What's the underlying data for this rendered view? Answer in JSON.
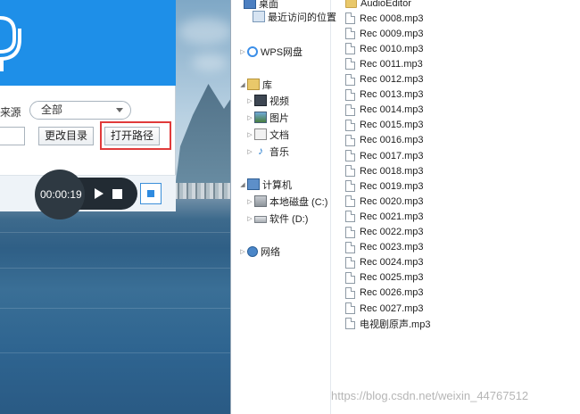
{
  "recorder": {
    "source_label": "来源",
    "source_select_value": "全部",
    "change_dir_label": "更改目录",
    "open_path_label": "打开路径",
    "timer": "00:00:19"
  },
  "explorer": {
    "nav": {
      "desktop": "桌面",
      "recent": "最近访问的位置",
      "wps": "WPS网盘",
      "library": "库",
      "video": "视频",
      "pictures": "图片",
      "documents": "文档",
      "music": "音乐",
      "computer": "计算机",
      "local_disk": "本地磁盘 (C:)",
      "software": "软件 (D:)",
      "network": "网络"
    },
    "files": [
      "AudioEditor",
      "Rec 0008.mp3",
      "Rec 0009.mp3",
      "Rec 0010.mp3",
      "Rec 0011.mp3",
      "Rec 0012.mp3",
      "Rec 0013.mp3",
      "Rec 0014.mp3",
      "Rec 0015.mp3",
      "Rec 0016.mp3",
      "Rec 0017.mp3",
      "Rec 0018.mp3",
      "Rec 0019.mp3",
      "Rec 0020.mp3",
      "Rec 0021.mp3",
      "Rec 0022.mp3",
      "Rec 0023.mp3",
      "Rec 0024.mp3",
      "Rec 0025.mp3",
      "Rec 0026.mp3",
      "Rec 0027.mp3",
      "电视剧原声.mp3"
    ]
  },
  "watermark": "https://blog.csdn.net/weixin_44767512",
  "colors": {
    "accent": "#1e8fe8",
    "highlight": "#e03a3a"
  }
}
